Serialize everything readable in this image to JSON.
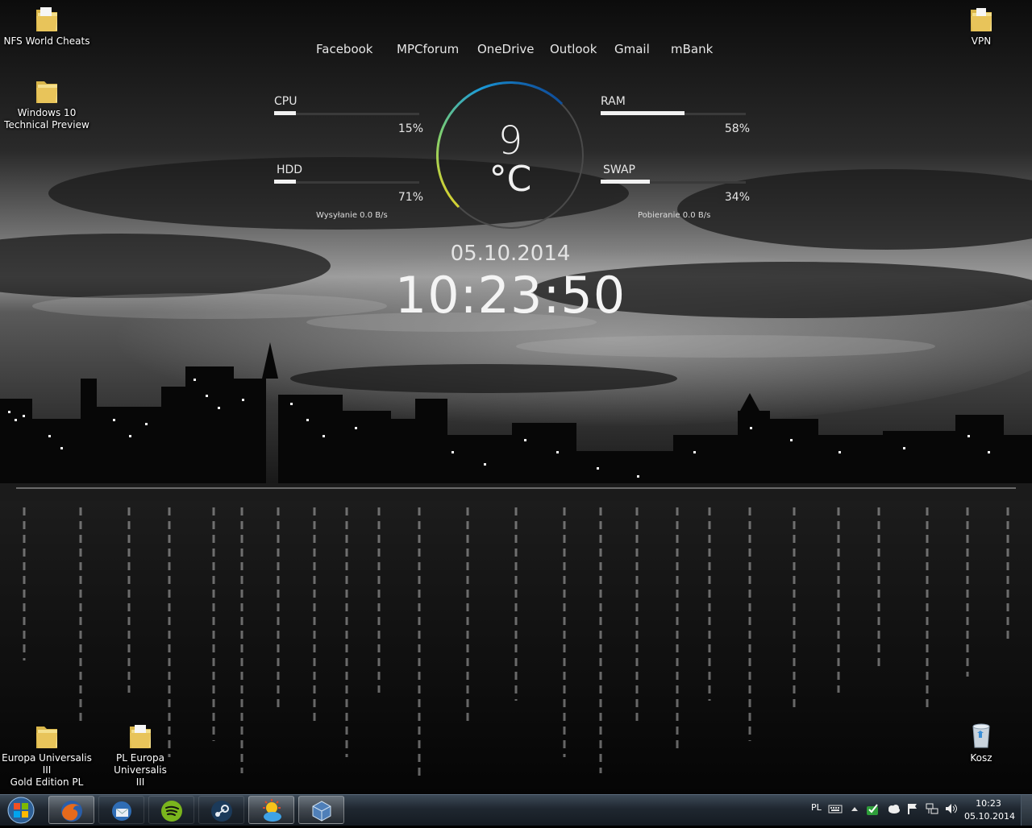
{
  "desktop": {
    "icons": [
      {
        "label": "NFS World Cheats"
      },
      {
        "label": "Windows 10\nTechnical Preview"
      },
      {
        "label": "VPN"
      },
      {
        "label": "Europa Universalis III\nGold Edition PL"
      },
      {
        "label": "PL Europa Universalis\nIII"
      },
      {
        "label": "Kosz"
      }
    ]
  },
  "widget": {
    "links": [
      "Facebook",
      "MPCforum",
      "OneDrive",
      "Outlook",
      "Gmail",
      "mBank"
    ],
    "cpu": {
      "label": "CPU",
      "value": "15%",
      "fraction": 0.15
    },
    "ram": {
      "label": "RAM",
      "value": "58%",
      "fraction": 0.58
    },
    "hdd": {
      "label": "HDD",
      "value": "71%",
      "fraction": 0.15
    },
    "swap": {
      "label": "SWAP",
      "value": "34%",
      "fraction": 0.34
    },
    "upload": "Wysyłanie   0.0 B/s",
    "download": "Pobieranie   0.0 B/s",
    "temperature": "9",
    "temperature_unit": "°C",
    "date": "05.10.2014",
    "time": "10:23:50"
  },
  "taskbar": {
    "apps": [
      "firefox-icon",
      "thunderbird-icon",
      "spotify-icon",
      "steam-icon",
      "weather-icon",
      "virtualbox-icon"
    ],
    "language": "PL",
    "clock_time": "10:23",
    "clock_date": "05.10.2014"
  },
  "colors": {
    "gauge_blue": "#1a78d4",
    "gauge_yellow": "#f2d21c",
    "taskbar": "#1f2730"
  }
}
